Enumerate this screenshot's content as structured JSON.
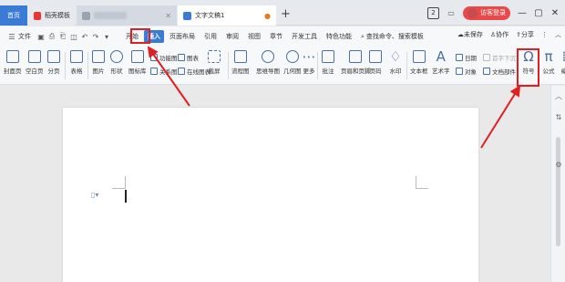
{
  "tabs": {
    "home": "首页",
    "template": "稻壳模板",
    "document": "文字文稿1",
    "new_tab": "+"
  },
  "window": {
    "login": "访客登录",
    "minimize": "—",
    "restore": "▢",
    "close": "✕"
  },
  "menu": {
    "file": "文件",
    "items": [
      "开始",
      "插入",
      "页面布局",
      "引用",
      "审阅",
      "视图",
      "章节",
      "开发工具",
      "特色功能"
    ],
    "search": "查找命令、搜索模板",
    "unsaved": "未保存",
    "collab": "协作",
    "share": "分享"
  },
  "ribbon": {
    "cover": "封面页",
    "blank": "空白页",
    "pagebreak": "分页",
    "table": "表格",
    "picture": "图片",
    "shape": "形状",
    "iconlib": "图标库",
    "funcimg": "功能图",
    "chart": "图表",
    "relation": "关系图",
    "onlinechart": "在线图表",
    "screenshot": "截屏",
    "flowchart": "流程图",
    "mindmap": "思维导图",
    "geometry": "几何图",
    "more": "更多",
    "comment": "批注",
    "headerfooter": "页眉和页脚",
    "pagenum": "页码",
    "watermark": "水印",
    "textbox": "文本框",
    "wordart": "艺术字",
    "date": "日期",
    "dropcap": "首字下沉",
    "object": "对象",
    "docparts": "文档部件",
    "symbol": "符号",
    "formula": "公式",
    "numbering": "编"
  }
}
